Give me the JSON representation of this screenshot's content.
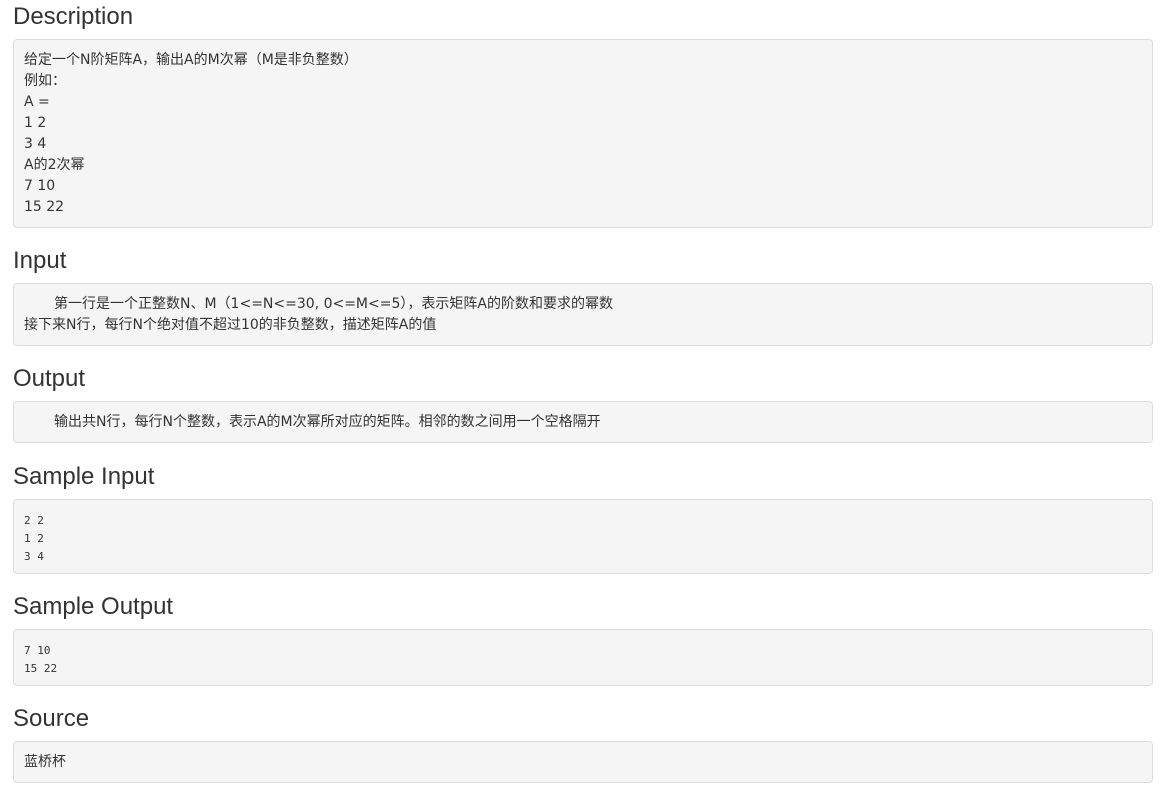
{
  "description": {
    "heading": "Description",
    "lines": [
      "给定一个N阶矩阵A，输出A的M次幂（M是非负整数）",
      "例如：",
      "A =",
      "1 2",
      "3 4",
      "A的2次幂",
      "7 10",
      "15 22"
    ]
  },
  "input": {
    "heading": "Input",
    "lines": [
      "第一行是一个正整数N、M（1<=N<=30, 0<=M<=5），表示矩阵A的阶数和要求的幂数",
      "接下来N行，每行N个绝对值不超过10的非负整数，描述矩阵A的值"
    ]
  },
  "output": {
    "heading": "Output",
    "lines": [
      "输出共N行，每行N个整数，表示A的M次幂所对应的矩阵。相邻的数之间用一个空格隔开"
    ]
  },
  "sample_input": {
    "heading": "Sample Input",
    "lines": [
      "2 2",
      "1 2",
      "3 4"
    ]
  },
  "sample_output": {
    "heading": "Sample Output",
    "lines": [
      "7 10",
      "15 22"
    ]
  },
  "source": {
    "heading": "Source",
    "lines": [
      "蓝桥杯"
    ]
  }
}
